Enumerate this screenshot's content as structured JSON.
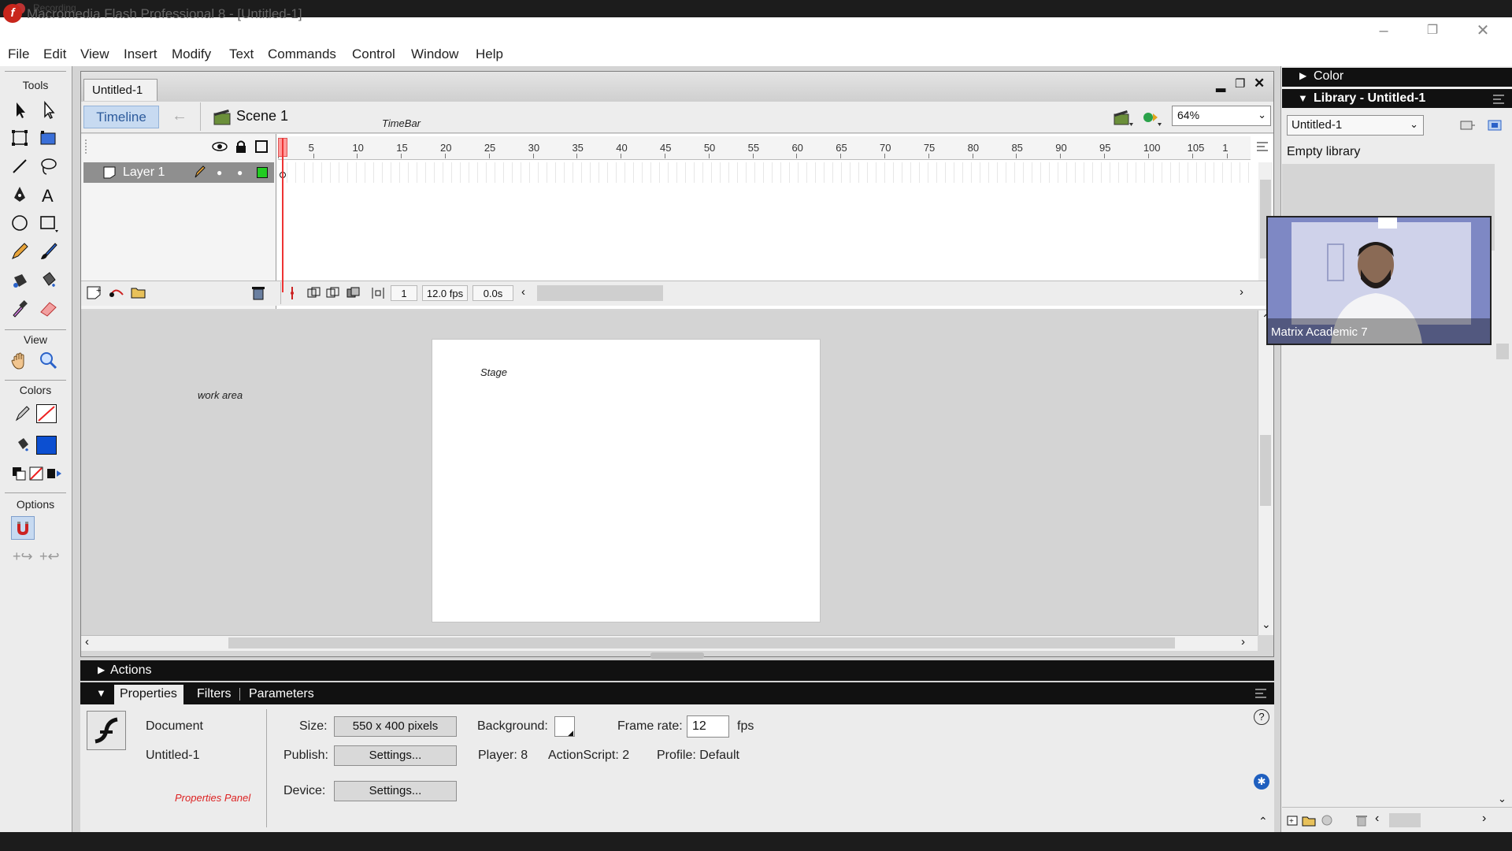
{
  "top_strip_text": "Recording",
  "app": {
    "title": "Macromedia Flash Professional 8 - [Untitled-1]",
    "logo_letter": "f"
  },
  "menu": [
    "File",
    "Edit",
    "View",
    "Insert",
    "Modify",
    "Text",
    "Commands",
    "Control",
    "Window",
    "Help"
  ],
  "tools": {
    "title": "Tools",
    "view_title": "View",
    "colors_title": "Colors",
    "options_title": "Options",
    "items": [
      "arrow-icon",
      "subselect-icon",
      "free-transform-icon",
      "fill-transform-icon",
      "line-icon",
      "lasso-icon",
      "pen-icon",
      "text-icon",
      "oval-icon",
      "rectangle-icon",
      "pencil-icon",
      "brush-icon",
      "ink-bottle-icon",
      "paint-bucket-icon",
      "eyedropper-icon",
      "eraser-icon",
      "hand-icon",
      "zoom-icon"
    ],
    "stroke_color": "#000000",
    "fill_color": "#0c4fd1"
  },
  "document": {
    "tab": "Untitled-1",
    "timeline_button": "Timeline",
    "scene": "Scene 1",
    "timebar_note": "TimeBar",
    "zoom": "64%"
  },
  "timeline": {
    "ruler_labels": [
      "1",
      "5",
      "10",
      "15",
      "20",
      "25",
      "30",
      "35",
      "40",
      "45",
      "50",
      "55",
      "60",
      "65",
      "70",
      "75",
      "80",
      "85",
      "90",
      "95",
      "100",
      "105",
      "1"
    ],
    "layer_name": "Layer 1",
    "layer_color": "#22cc22",
    "current_frame": "1",
    "frame_rate": "12.0 fps",
    "elapsed": "0.0s"
  },
  "stage": {
    "stage_note": "Stage",
    "work_area_note": "work area"
  },
  "panels": {
    "actions": "Actions",
    "tabs": [
      "Properties",
      "Filters",
      "Parameters"
    ]
  },
  "properties": {
    "doc_type": "Document",
    "doc_name": "Untitled-1",
    "size_label": "Size:",
    "size_value": "550 x 400 pixels",
    "background_label": "Background:",
    "frame_rate_label": "Frame rate:",
    "frame_rate_value": "12",
    "fps": "fps",
    "publish_label": "Publish:",
    "settings": "Settings...",
    "player": "Player: 8",
    "actionscript": "ActionScript:  2",
    "profile": "Profile:  Default",
    "device_label": "Device:",
    "panel_note": "Properties Panel"
  },
  "right": {
    "color_title": "Color",
    "library_title": "Library - Untitled-1",
    "library_select": "Untitled-1",
    "empty": "Empty library"
  },
  "webcam": {
    "label": "Matrix Academic 7"
  }
}
